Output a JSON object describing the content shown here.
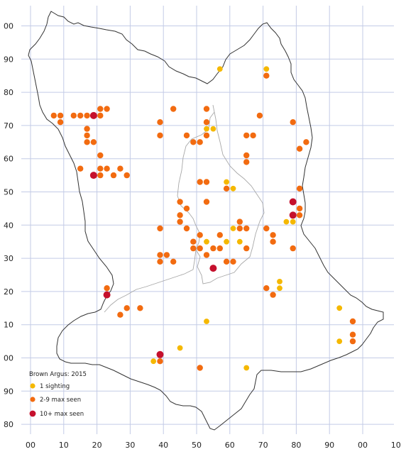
{
  "map": {
    "legend": {
      "title": "Brown Argus:  2015",
      "items": [
        {
          "label": "1 sighting",
          "color": "#f5b800"
        },
        {
          "label": "2-9 max seen",
          "color": "#f26b10"
        },
        {
          "label": "10+ max seen",
          "color": "#c5102d"
        }
      ]
    },
    "x_ticks": [
      "00",
      "10",
      "20",
      "30",
      "40",
      "50",
      "60",
      "70",
      "80",
      "90",
      "00",
      "10"
    ],
    "y_ticks": [
      "00",
      "90",
      "80",
      "70",
      "60",
      "50",
      "40",
      "30",
      "20",
      "10",
      "00",
      "90",
      "80"
    ],
    "grid_color": "#c3cbe6",
    "boundary_color": "#333333",
    "inner_boundary_color": "#a8a8a8"
  },
  "chart_data": {
    "type": "scatter",
    "series": [
      {
        "name": "1 sighting",
        "color": "#f5b800",
        "points": [
          [
            57,
            87
          ],
          [
            71,
            87
          ],
          [
            53,
            69
          ],
          [
            55,
            69
          ],
          [
            59,
            53
          ],
          [
            61,
            51
          ],
          [
            61,
            39
          ],
          [
            59,
            35
          ],
          [
            53,
            35
          ],
          [
            63,
            35
          ],
          [
            77,
            41
          ],
          [
            79,
            41
          ],
          [
            75,
            23
          ],
          [
            75,
            21
          ],
          [
            53,
            11
          ],
          [
            45,
            3
          ],
          [
            37,
            -1
          ],
          [
            65,
            -3
          ],
          [
            93,
            15
          ],
          [
            93,
            5
          ]
        ]
      },
      {
        "name": "2-9 max seen",
        "color": "#f26b10",
        "points": [
          [
            7,
            73
          ],
          [
            9,
            73
          ],
          [
            9,
            71
          ],
          [
            13,
            73
          ],
          [
            15,
            73
          ],
          [
            17,
            73
          ],
          [
            19,
            73
          ],
          [
            21,
            73
          ],
          [
            21,
            75
          ],
          [
            23,
            75
          ],
          [
            17,
            69
          ],
          [
            17,
            67
          ],
          [
            17,
            65
          ],
          [
            19,
            65
          ],
          [
            21,
            61
          ],
          [
            15,
            57
          ],
          [
            21,
            57
          ],
          [
            23,
            57
          ],
          [
            21,
            55
          ],
          [
            25,
            55
          ],
          [
            27,
            57
          ],
          [
            29,
            55
          ],
          [
            39,
            71
          ],
          [
            39,
            67
          ],
          [
            43,
            75
          ],
          [
            53,
            75
          ],
          [
            53,
            71
          ],
          [
            53,
            67
          ],
          [
            47,
            67
          ],
          [
            49,
            65
          ],
          [
            51,
            65
          ],
          [
            65,
            67
          ],
          [
            67,
            67
          ],
          [
            69,
            73
          ],
          [
            71,
            85
          ],
          [
            79,
            71
          ],
          [
            81,
            63
          ],
          [
            83,
            65
          ],
          [
            65,
            61
          ],
          [
            65,
            59
          ],
          [
            51,
            53
          ],
          [
            53,
            53
          ],
          [
            59,
            51
          ],
          [
            53,
            47
          ],
          [
            45,
            47
          ],
          [
            45,
            43
          ],
          [
            45,
            41
          ],
          [
            47,
            45
          ],
          [
            47,
            39
          ],
          [
            39,
            39
          ],
          [
            51,
            37
          ],
          [
            57,
            37
          ],
          [
            49,
            35
          ],
          [
            49,
            33
          ],
          [
            51,
            33
          ],
          [
            53,
            31
          ],
          [
            55,
            33
          ],
          [
            57,
            33
          ],
          [
            63,
            41
          ],
          [
            63,
            39
          ],
          [
            65,
            39
          ],
          [
            65,
            33
          ],
          [
            59,
            29
          ],
          [
            61,
            29
          ],
          [
            71,
            39
          ],
          [
            73,
            37
          ],
          [
            73,
            35
          ],
          [
            79,
            33
          ],
          [
            81,
            51
          ],
          [
            81,
            45
          ],
          [
            81,
            43
          ],
          [
            39,
            31
          ],
          [
            39,
            29
          ],
          [
            41,
            31
          ],
          [
            43,
            29
          ],
          [
            71,
            21
          ],
          [
            73,
            19
          ],
          [
            23,
            21
          ],
          [
            29,
            15
          ],
          [
            33,
            15
          ],
          [
            27,
            13
          ],
          [
            97,
            11
          ],
          [
            97,
            7
          ],
          [
            97,
            5
          ],
          [
            39,
            -1
          ],
          [
            51,
            -3
          ]
        ]
      },
      {
        "name": "10+ max seen",
        "color": "#c5102d",
        "points": [
          [
            19,
            73
          ],
          [
            19,
            55
          ],
          [
            79,
            47
          ],
          [
            79,
            43
          ],
          [
            55,
            27
          ],
          [
            23,
            19
          ],
          [
            39,
            1
          ]
        ]
      }
    ]
  }
}
